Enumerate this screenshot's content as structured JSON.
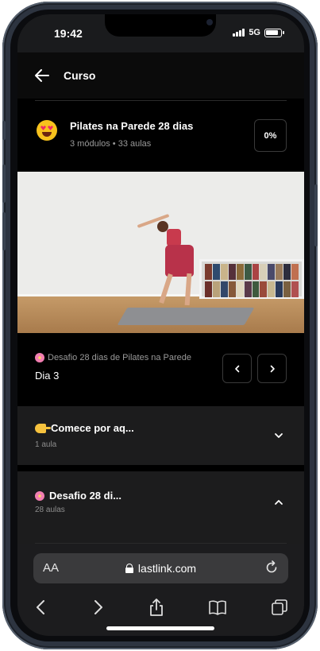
{
  "status_bar": {
    "time": "19:42",
    "network": "5G"
  },
  "header": {
    "title": "Curso"
  },
  "course": {
    "title": "Pilates na Parede 28 dias",
    "meta": "3 módulos  •  33 aulas",
    "progress": "0%"
  },
  "lesson": {
    "module": "Desafio 28 dias de Pilates na Parede",
    "title": "Dia 3",
    "prev_label": "‹",
    "next_label": "›"
  },
  "modules": [
    {
      "title": "Comece por aq...",
      "subtitle": "1 aula"
    },
    {
      "title": "Desafio 28 di...",
      "subtitle": "28 aulas"
    }
  ],
  "browser": {
    "text_size_label": "AA",
    "url": "lastlink.com"
  },
  "colors": {
    "accent_pink": "#f27eb1",
    "emoji_yellow": "#f7c21d",
    "card_bg": "#1c1c1d"
  }
}
